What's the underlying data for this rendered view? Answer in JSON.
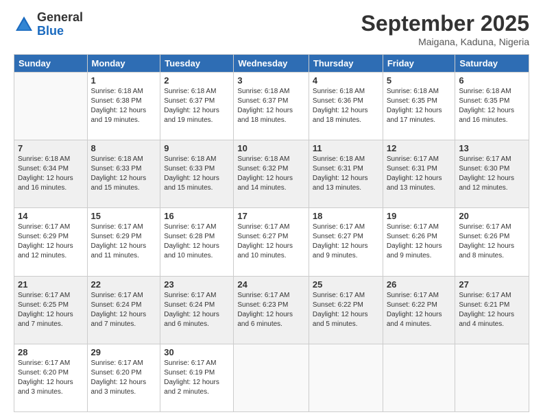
{
  "logo": {
    "general": "General",
    "blue": "Blue"
  },
  "header": {
    "month": "September 2025",
    "location": "Maigana, Kaduna, Nigeria"
  },
  "weekdays": [
    "Sunday",
    "Monday",
    "Tuesday",
    "Wednesday",
    "Thursday",
    "Friday",
    "Saturday"
  ],
  "weeks": [
    [
      {
        "day": "",
        "info": ""
      },
      {
        "day": "1",
        "info": "Sunrise: 6:18 AM\nSunset: 6:38 PM\nDaylight: 12 hours\nand 19 minutes."
      },
      {
        "day": "2",
        "info": "Sunrise: 6:18 AM\nSunset: 6:37 PM\nDaylight: 12 hours\nand 19 minutes."
      },
      {
        "day": "3",
        "info": "Sunrise: 6:18 AM\nSunset: 6:37 PM\nDaylight: 12 hours\nand 18 minutes."
      },
      {
        "day": "4",
        "info": "Sunrise: 6:18 AM\nSunset: 6:36 PM\nDaylight: 12 hours\nand 18 minutes."
      },
      {
        "day": "5",
        "info": "Sunrise: 6:18 AM\nSunset: 6:35 PM\nDaylight: 12 hours\nand 17 minutes."
      },
      {
        "day": "6",
        "info": "Sunrise: 6:18 AM\nSunset: 6:35 PM\nDaylight: 12 hours\nand 16 minutes."
      }
    ],
    [
      {
        "day": "7",
        "info": "Sunrise: 6:18 AM\nSunset: 6:34 PM\nDaylight: 12 hours\nand 16 minutes."
      },
      {
        "day": "8",
        "info": "Sunrise: 6:18 AM\nSunset: 6:33 PM\nDaylight: 12 hours\nand 15 minutes."
      },
      {
        "day": "9",
        "info": "Sunrise: 6:18 AM\nSunset: 6:33 PM\nDaylight: 12 hours\nand 15 minutes."
      },
      {
        "day": "10",
        "info": "Sunrise: 6:18 AM\nSunset: 6:32 PM\nDaylight: 12 hours\nand 14 minutes."
      },
      {
        "day": "11",
        "info": "Sunrise: 6:18 AM\nSunset: 6:31 PM\nDaylight: 12 hours\nand 13 minutes."
      },
      {
        "day": "12",
        "info": "Sunrise: 6:17 AM\nSunset: 6:31 PM\nDaylight: 12 hours\nand 13 minutes."
      },
      {
        "day": "13",
        "info": "Sunrise: 6:17 AM\nSunset: 6:30 PM\nDaylight: 12 hours\nand 12 minutes."
      }
    ],
    [
      {
        "day": "14",
        "info": "Sunrise: 6:17 AM\nSunset: 6:29 PM\nDaylight: 12 hours\nand 12 minutes."
      },
      {
        "day": "15",
        "info": "Sunrise: 6:17 AM\nSunset: 6:29 PM\nDaylight: 12 hours\nand 11 minutes."
      },
      {
        "day": "16",
        "info": "Sunrise: 6:17 AM\nSunset: 6:28 PM\nDaylight: 12 hours\nand 10 minutes."
      },
      {
        "day": "17",
        "info": "Sunrise: 6:17 AM\nSunset: 6:27 PM\nDaylight: 12 hours\nand 10 minutes."
      },
      {
        "day": "18",
        "info": "Sunrise: 6:17 AM\nSunset: 6:27 PM\nDaylight: 12 hours\nand 9 minutes."
      },
      {
        "day": "19",
        "info": "Sunrise: 6:17 AM\nSunset: 6:26 PM\nDaylight: 12 hours\nand 9 minutes."
      },
      {
        "day": "20",
        "info": "Sunrise: 6:17 AM\nSunset: 6:26 PM\nDaylight: 12 hours\nand 8 minutes."
      }
    ],
    [
      {
        "day": "21",
        "info": "Sunrise: 6:17 AM\nSunset: 6:25 PM\nDaylight: 12 hours\nand 7 minutes."
      },
      {
        "day": "22",
        "info": "Sunrise: 6:17 AM\nSunset: 6:24 PM\nDaylight: 12 hours\nand 7 minutes."
      },
      {
        "day": "23",
        "info": "Sunrise: 6:17 AM\nSunset: 6:24 PM\nDaylight: 12 hours\nand 6 minutes."
      },
      {
        "day": "24",
        "info": "Sunrise: 6:17 AM\nSunset: 6:23 PM\nDaylight: 12 hours\nand 6 minutes."
      },
      {
        "day": "25",
        "info": "Sunrise: 6:17 AM\nSunset: 6:22 PM\nDaylight: 12 hours\nand 5 minutes."
      },
      {
        "day": "26",
        "info": "Sunrise: 6:17 AM\nSunset: 6:22 PM\nDaylight: 12 hours\nand 4 minutes."
      },
      {
        "day": "27",
        "info": "Sunrise: 6:17 AM\nSunset: 6:21 PM\nDaylight: 12 hours\nand 4 minutes."
      }
    ],
    [
      {
        "day": "28",
        "info": "Sunrise: 6:17 AM\nSunset: 6:20 PM\nDaylight: 12 hours\nand 3 minutes."
      },
      {
        "day": "29",
        "info": "Sunrise: 6:17 AM\nSunset: 6:20 PM\nDaylight: 12 hours\nand 3 minutes."
      },
      {
        "day": "30",
        "info": "Sunrise: 6:17 AM\nSunset: 6:19 PM\nDaylight: 12 hours\nand 2 minutes."
      },
      {
        "day": "",
        "info": ""
      },
      {
        "day": "",
        "info": ""
      },
      {
        "day": "",
        "info": ""
      },
      {
        "day": "",
        "info": ""
      }
    ]
  ]
}
